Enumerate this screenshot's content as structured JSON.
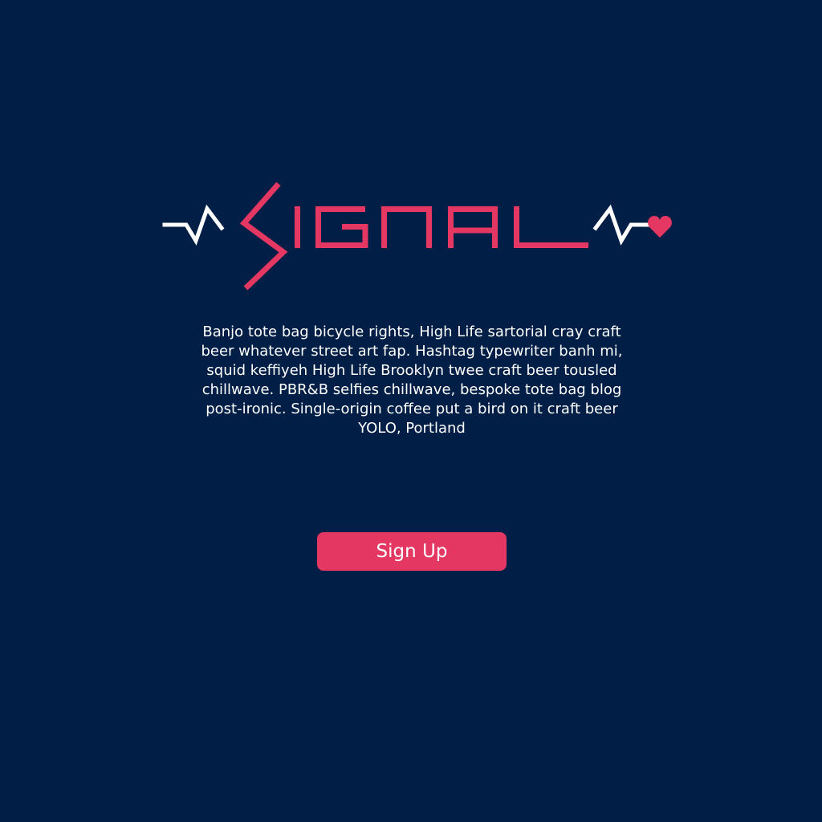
{
  "logo": {
    "wordmark": "SIGNAL",
    "accent_color": "#e43762",
    "pulse_color": "#ffffff",
    "icons": [
      "heartbeat-pulse-icon",
      "heart-icon"
    ]
  },
  "intro": {
    "text": "Banjo tote bag bicycle rights, High Life sartorial cray craft beer whatever street art fap. Hashtag typewriter banh mi, squid keffiyeh High Life Brooklyn twee craft beer tousled chillwave. PBR&B selfies chillwave, bespoke tote bag blog post-ironic. Single-origin coffee put a bird on it craft beer YOLO, Portland"
  },
  "signup": {
    "label": "Sign Up",
    "color": "#e43762"
  },
  "theme": {
    "background": "#001e46",
    "text": "#ffffff"
  }
}
